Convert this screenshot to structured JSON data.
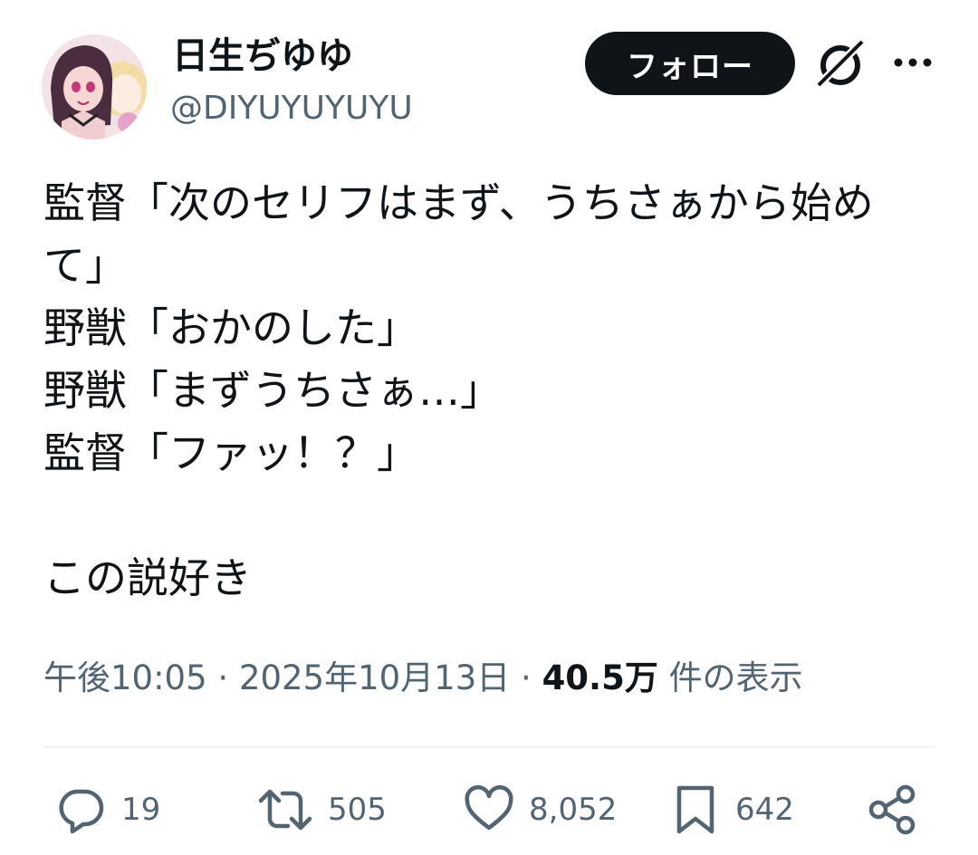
{
  "author": {
    "display_name": "日生ぢゆゆ",
    "handle": "@DIYUYUYUYU",
    "avatar_icon": "avatar-illustration"
  },
  "header": {
    "follow_label": "フォロー",
    "grok_icon": "grok-icon",
    "more_icon": "more-dots-icon"
  },
  "tweet": {
    "text": "監督「次のセリフはまず、うちさぁから始めて」\n野獣「おかのした」\n野獣「まずうちさぁ…」\n監督「ファッ！？」\n\nこの説好き"
  },
  "meta": {
    "time": "午後10:05",
    "separator": "·",
    "date": "2025年10月13日",
    "views_count": "40.5万",
    "views_label": "件の表示"
  },
  "actions": {
    "reply": {
      "icon": "reply-icon",
      "count": "19"
    },
    "retweet": {
      "icon": "retweet-icon",
      "count": "505"
    },
    "like": {
      "icon": "heart-icon",
      "count": "8,052"
    },
    "bookmark": {
      "icon": "bookmark-icon",
      "count": "642"
    },
    "share": {
      "icon": "share-icon"
    }
  },
  "colors": {
    "text_primary": "#0f1419",
    "text_secondary": "#536471",
    "follow_button_bg": "#0f1419",
    "follow_button_text": "#ffffff",
    "divider": "#eff3f4"
  }
}
